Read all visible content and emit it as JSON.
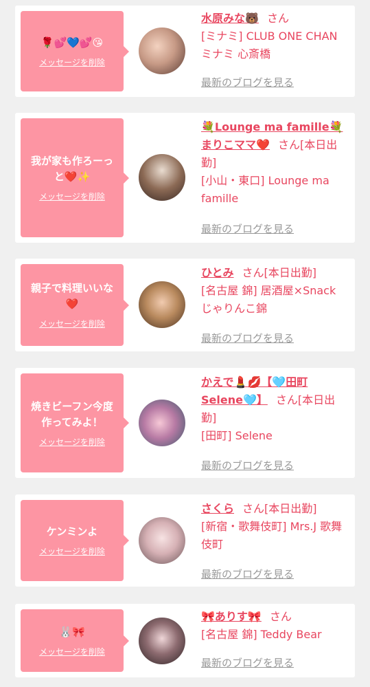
{
  "delete_label": "メッセージを削除",
  "blog_label": "最新のブログを見る",
  "san_label": "さん",
  "cards": [
    {
      "message": "🌹💕💙💕😘",
      "name": "水原みな🐻",
      "shift": "",
      "area": "[ミナミ] CLUB ONE CHAN ミナミ 心斎橋"
    },
    {
      "message": "我が家も作ろーっと❤️✨",
      "name": "💐Lounge ma famille💐まりこママ❤️",
      "shift": "[本日出勤]",
      "area": "[小山・東口] Lounge ma famille"
    },
    {
      "message": "親子で料理いいな❤️",
      "name": "ひとみ",
      "shift": "[本日出勤]",
      "area": "[名古屋 錦] 居酒屋×Snack じゃりんこ錦"
    },
    {
      "message": "焼きビーフン今度作ってみよ！",
      "name": "かえで💄💋【🩵田町Selene🩵】",
      "shift": "[本日出勤]",
      "area": "[田町] Selene"
    },
    {
      "message": "ケンミンよ",
      "name": "さくら",
      "shift": "[本日出勤]",
      "area": "[新宿・歌舞伎町] Mrs.J 歌舞伎町"
    },
    {
      "message": "🐰🎀",
      "name": "🎀ありす🎀",
      "shift": "",
      "area": "[名古屋 錦] Teddy Bear"
    }
  ]
}
